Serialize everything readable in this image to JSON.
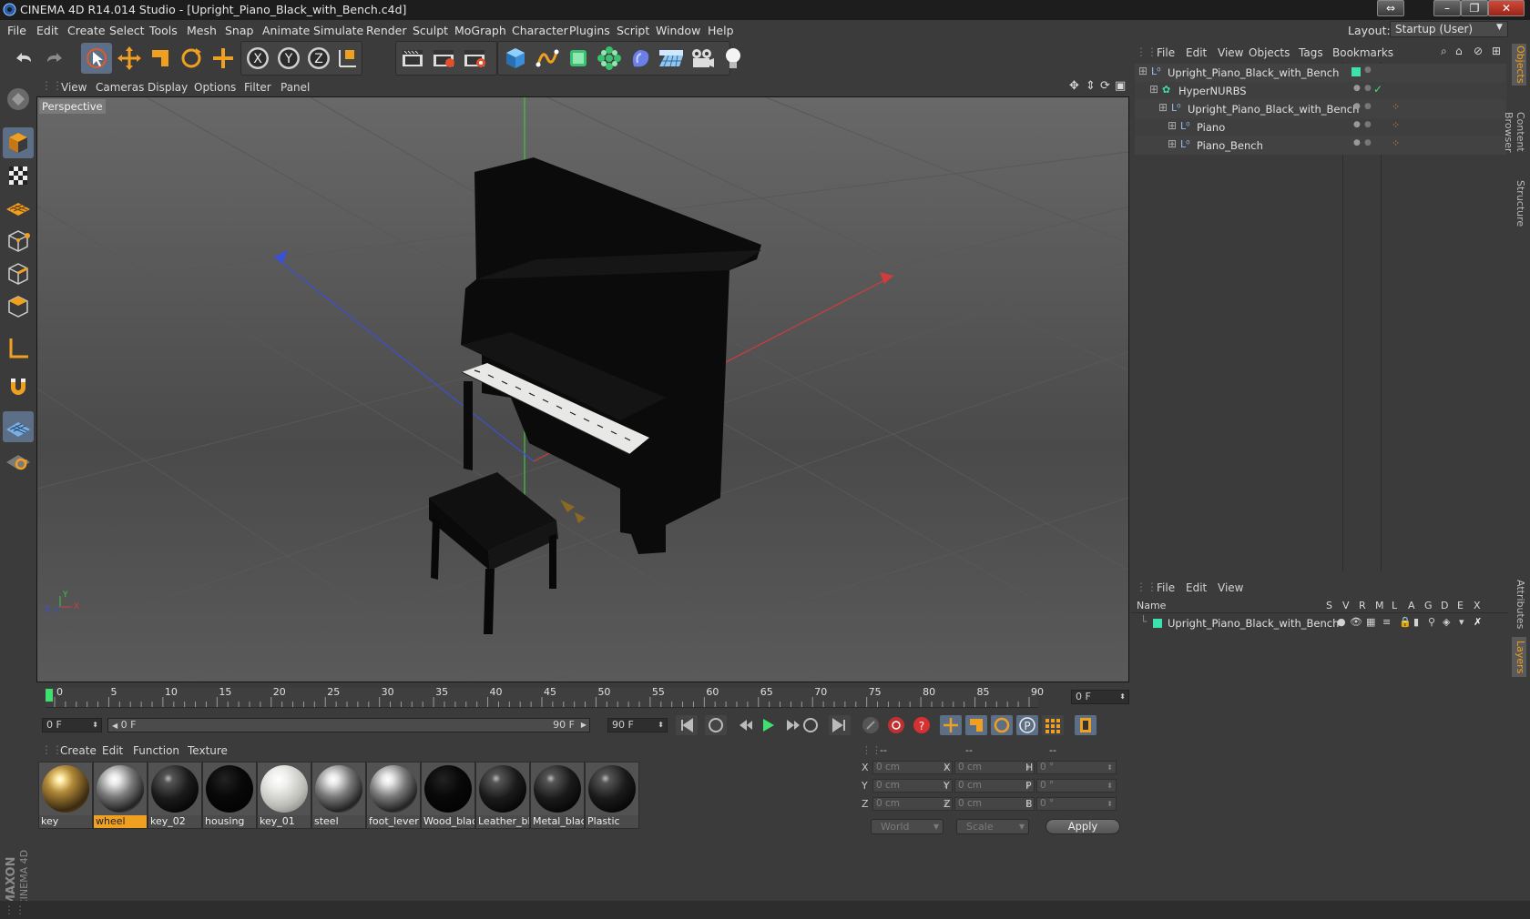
{
  "window": {
    "title": "CINEMA 4D R14.014 Studio - [Upright_Piano_Black_with_Bench.c4d]"
  },
  "menu": [
    "File",
    "Edit",
    "Create",
    "Select",
    "Tools",
    "Mesh",
    "Snap",
    "Animate",
    "Simulate",
    "Render",
    "Sculpt",
    "MoGraph",
    "Character",
    "Plugins",
    "Script",
    "Window",
    "Help"
  ],
  "layout": {
    "label": "Layout:",
    "value": "Startup (User)"
  },
  "toolbar": {
    "icons": [
      "undo-icon",
      "redo-icon",
      "live-selection-icon",
      "move-icon",
      "scale-icon",
      "rotate-icon",
      "add-icon",
      "x-axis-icon",
      "y-axis-icon",
      "z-axis-icon",
      "coordinate-system-icon",
      "render-view-icon",
      "render-picture-viewer-icon",
      "edit-render-settings-icon",
      "cube-icon",
      "spline-icon",
      "nurbs-icon",
      "array-icon",
      "deformer-icon",
      "floor-icon",
      "camera-icon",
      "light-icon"
    ]
  },
  "left_toolbar": {
    "icons": [
      "make-editable-icon",
      "model-mode-icon",
      "texture-mode-icon",
      "workplane-icon",
      "points-mode-icon",
      "edges-mode-icon",
      "polygons-mode-icon",
      "axis-icon",
      "magnet-icon",
      "snap-grid-icon",
      "locked-workplane-icon"
    ]
  },
  "viewport": {
    "menu": [
      "View",
      "Cameras",
      "Display",
      "Options",
      "Filter",
      "Panel"
    ],
    "label": "Perspective",
    "axis_labels": {
      "x": "X",
      "y": "Y",
      "z": "Z"
    }
  },
  "timeline": {
    "ticks": [
      "0",
      "5",
      "10",
      "15",
      "20",
      "25",
      "30",
      "35",
      "40",
      "45",
      "50",
      "55",
      "60",
      "65",
      "70",
      "75",
      "80",
      "85",
      "90"
    ],
    "current_frame": "0 F",
    "start_frame": "0 F",
    "range_start": "0 F",
    "range_end": "90 F",
    "end_frame": "90 F"
  },
  "materials": {
    "menu": [
      "Create",
      "Edit",
      "Function",
      "Texture"
    ],
    "items": [
      {
        "name": "key",
        "type": "gold"
      },
      {
        "name": "wheel",
        "type": "chrome",
        "selected": true
      },
      {
        "name": "key_02",
        "type": "darkgloss"
      },
      {
        "name": "housing",
        "type": "black"
      },
      {
        "name": "key_01",
        "type": "white"
      },
      {
        "name": "steel",
        "type": "chrome"
      },
      {
        "name": "foot_lever",
        "type": "chrome"
      },
      {
        "name": "Wood_blac",
        "type": "black"
      },
      {
        "name": "Leather_bla",
        "type": "darkgloss"
      },
      {
        "name": "Metal_blac",
        "type": "darkgloss"
      },
      {
        "name": "Plastic",
        "type": "darkgloss"
      }
    ]
  },
  "coordinates": {
    "headers": [
      "--",
      "--",
      "--"
    ],
    "rows": [
      {
        "a": "X",
        "av": "0 cm",
        "b": "X",
        "bv": "0 cm",
        "c": "H",
        "cv": "0 °"
      },
      {
        "a": "Y",
        "av": "0 cm",
        "b": "Y",
        "bv": "0 cm",
        "c": "P",
        "cv": "0 °"
      },
      {
        "a": "Z",
        "av": "0 cm",
        "b": "Z",
        "bv": "0 cm",
        "c": "B",
        "cv": "0 °"
      }
    ],
    "mode": "World",
    "scale": "Scale",
    "apply": "Apply"
  },
  "object_manager": {
    "menu": [
      "File",
      "Edit",
      "View",
      "Objects",
      "Tags",
      "Bookmarks"
    ],
    "objects": [
      {
        "name": "Upright_Piano_Black_with_Bench",
        "level": 0
      },
      {
        "name": "HyperNURBS",
        "level": 1
      },
      {
        "name": "Upright_Piano_Black_with_Bench",
        "level": 2
      },
      {
        "name": "Piano",
        "level": 3
      },
      {
        "name": "Piano_Bench",
        "level": 3
      }
    ]
  },
  "layer_manager": {
    "menu": [
      "File",
      "Edit",
      "View"
    ],
    "columns": [
      "Name",
      "S",
      "V",
      "R",
      "M",
      "L",
      "A",
      "G",
      "D",
      "E",
      "X"
    ],
    "layers": [
      {
        "name": "Upright_Piano_Black_with_Bench",
        "color": "#3fe0b0"
      }
    ]
  },
  "side_tabs": [
    "Objects",
    "Content Browser",
    "Structure",
    "Attributes",
    "Layers"
  ],
  "branding": {
    "logo_text": "MAXON CINEMA 4D"
  },
  "colors": {
    "accent": "#f0a020",
    "selection": "#5d6f86",
    "x_axis": "#d23c3c",
    "y_axis": "#3cc83c",
    "z_axis": "#3c50d2",
    "layer": "#3fe0b0"
  }
}
